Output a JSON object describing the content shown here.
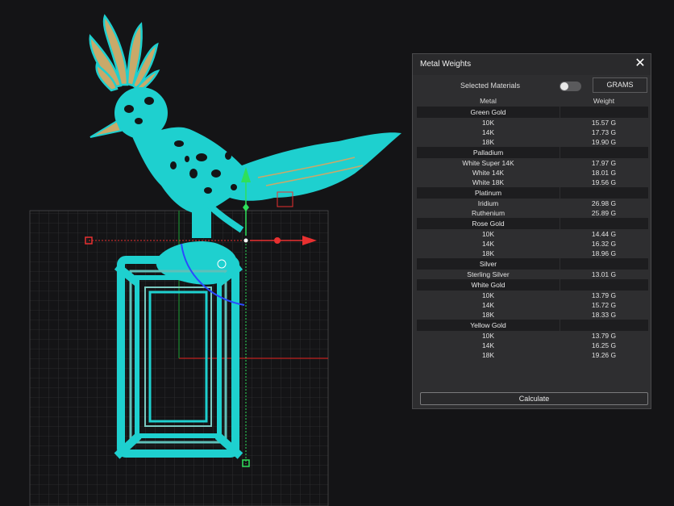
{
  "panel": {
    "title": "Metal Weights",
    "close_icon": "close-icon",
    "selected_materials_label": "Selected Materials",
    "toggle_on": false,
    "units_button": "GRAMS",
    "columns": {
      "metal": "Metal",
      "weight": "Weight"
    },
    "groups": [
      {
        "name": "Green Gold",
        "items": [
          {
            "metal": "10K",
            "weight": "15.57 G"
          },
          {
            "metal": "14K",
            "weight": "17.73 G"
          },
          {
            "metal": "18K",
            "weight": "19.90 G"
          }
        ]
      },
      {
        "name": "Palladium",
        "items": [
          {
            "metal": "White Super 14K",
            "weight": "17.97 G"
          },
          {
            "metal": "White 14K",
            "weight": "18.01 G"
          },
          {
            "metal": "White 18K",
            "weight": "19.56 G"
          }
        ]
      },
      {
        "name": "Platinum",
        "items": [
          {
            "metal": "Iridium",
            "weight": "26.98 G"
          },
          {
            "metal": "Ruthenium",
            "weight": "25.89 G"
          }
        ]
      },
      {
        "name": "Rose Gold",
        "items": [
          {
            "metal": "10K",
            "weight": "14.44 G"
          },
          {
            "metal": "14K",
            "weight": "16.32 G"
          },
          {
            "metal": "18K",
            "weight": "18.96 G"
          }
        ]
      },
      {
        "name": "Silver",
        "items": [
          {
            "metal": "Sterling Silver",
            "weight": "13.01 G"
          }
        ]
      },
      {
        "name": "White Gold",
        "items": [
          {
            "metal": "10K",
            "weight": "13.79 G"
          },
          {
            "metal": "14K",
            "weight": "15.72 G"
          },
          {
            "metal": "18K",
            "weight": "18.33 G"
          }
        ]
      },
      {
        "name": "Yellow Gold",
        "items": [
          {
            "metal": "10K",
            "weight": "13.79 G"
          },
          {
            "metal": "14K",
            "weight": "16.25 G"
          },
          {
            "metal": "18K",
            "weight": "19.26 G"
          }
        ]
      }
    ],
    "calculate_button": "Calculate"
  },
  "viewport": {
    "model_color": "#1ed0cf",
    "accent_gold": "#c9a96a",
    "axis_x_color": "#e83030",
    "axis_y_color": "#2ee05a",
    "rotate_color": "#2a4aff",
    "grid_color": "#3a3a3c"
  }
}
